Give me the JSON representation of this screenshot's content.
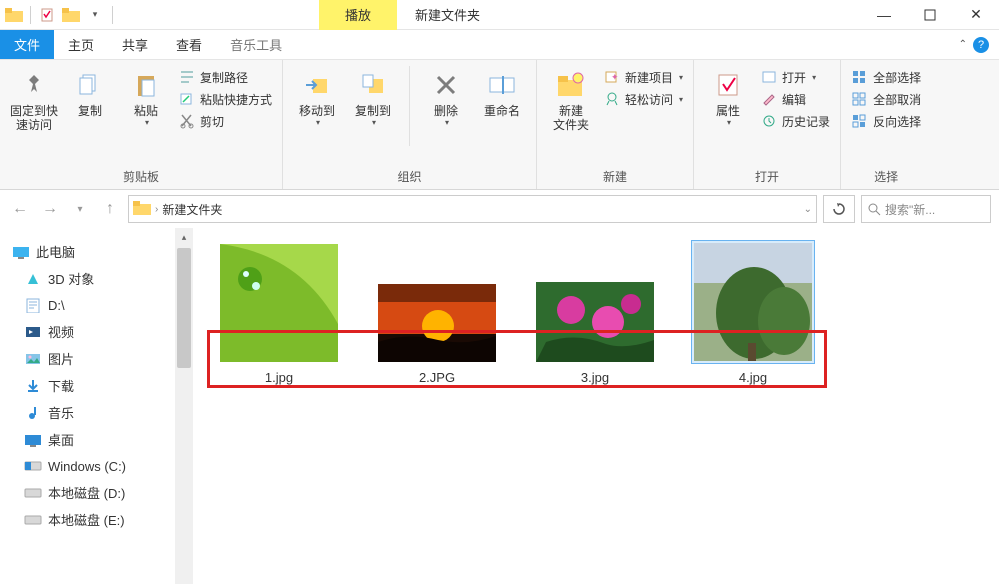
{
  "window": {
    "context_tab": "播放",
    "title": "新建文件夹"
  },
  "menu": {
    "file": "文件",
    "home": "主页",
    "share": "共享",
    "view": "查看",
    "music_tools": "音乐工具"
  },
  "ribbon": {
    "clipboard": {
      "pin": "固定到快\n速访问",
      "copy": "复制",
      "paste": "粘贴",
      "copy_path": "复制路径",
      "paste_shortcut": "粘贴快捷方式",
      "cut": "剪切",
      "group": "剪贴板"
    },
    "organize": {
      "move_to": "移动到",
      "copy_to": "复制到",
      "delete": "删除",
      "rename": "重命名",
      "group": "组织"
    },
    "new": {
      "new_folder": "新建\n文件夹",
      "new_item": "新建项目",
      "easy_access": "轻松访问",
      "group": "新建"
    },
    "open": {
      "properties": "属性",
      "open": "打开",
      "edit": "编辑",
      "history": "历史记录",
      "group": "打开"
    },
    "select": {
      "select_all": "全部选择",
      "select_none": "全部取消",
      "invert": "反向选择",
      "group": "选择"
    }
  },
  "nav": {
    "breadcrumb": "新建文件夹",
    "search_placeholder": "搜索\"新..."
  },
  "sidebar": {
    "items": [
      {
        "label": "此电脑",
        "header": true
      },
      {
        "label": "3D 对象"
      },
      {
        "label": "D:\\"
      },
      {
        "label": "视频"
      },
      {
        "label": "图片"
      },
      {
        "label": "下载"
      },
      {
        "label": "音乐"
      },
      {
        "label": "桌面"
      },
      {
        "label": "Windows (C:)"
      },
      {
        "label": "本地磁盘 (D:)"
      },
      {
        "label": "本地磁盘 (E:)"
      }
    ]
  },
  "files": [
    {
      "name": "1.jpg",
      "selected": false
    },
    {
      "name": "2.JPG",
      "selected": false
    },
    {
      "name": "3.jpg",
      "selected": false
    },
    {
      "name": "4.jpg",
      "selected": true
    }
  ]
}
